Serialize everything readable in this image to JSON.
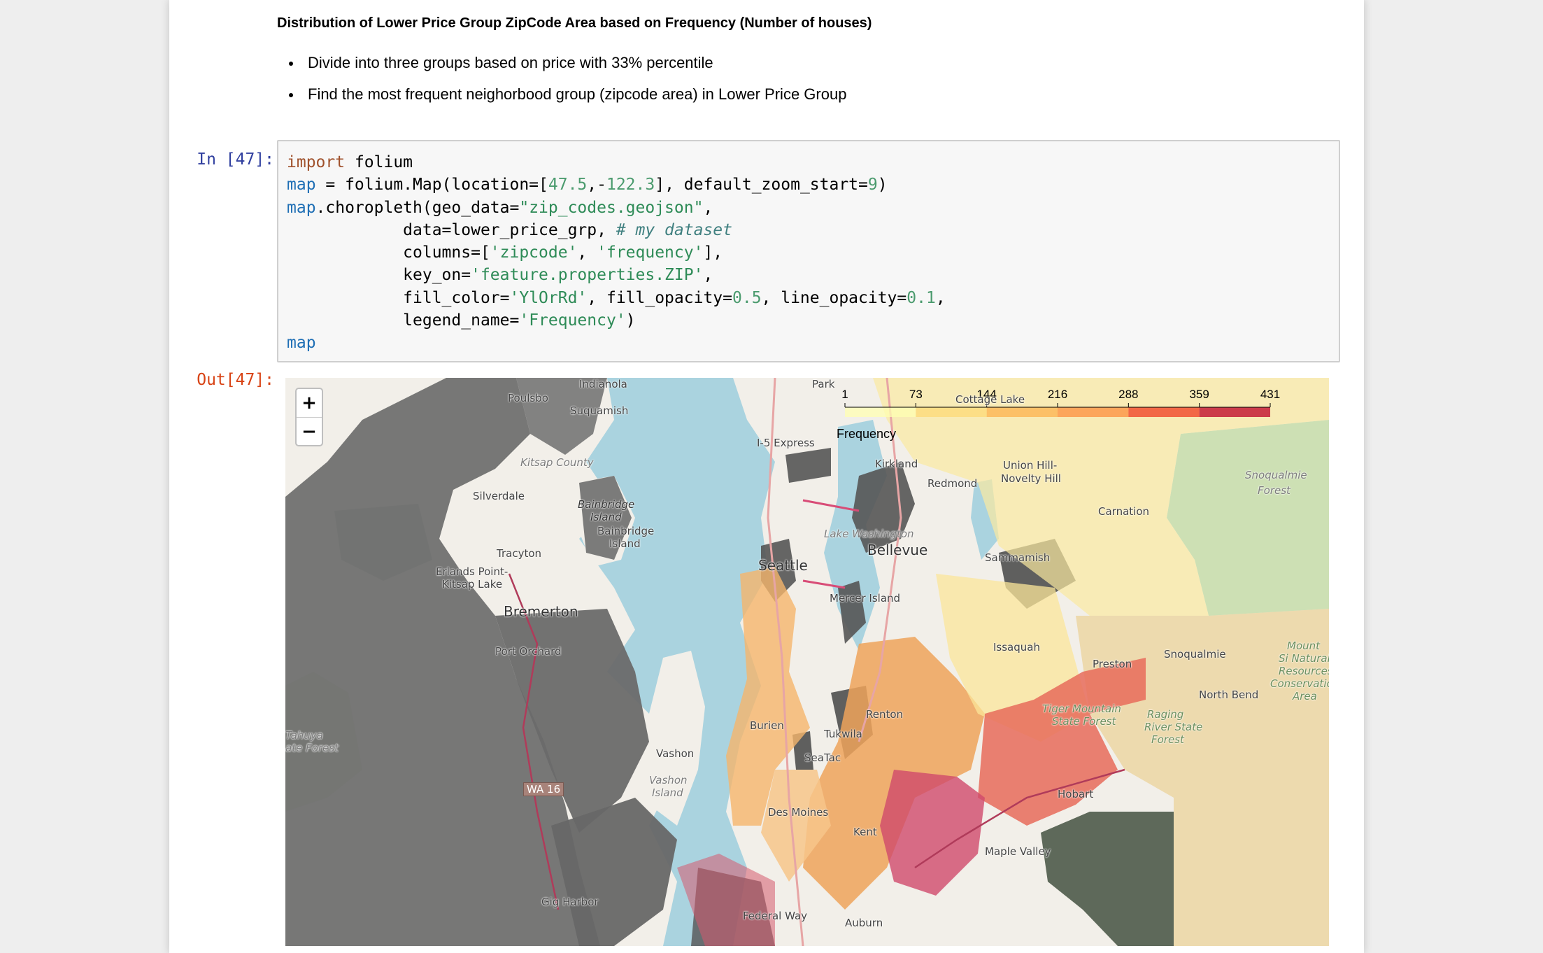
{
  "markdown": {
    "heading": "Distribution of Lower Price Group ZipCode Area based on Frequency (Number of houses)",
    "bullets": [
      "Divide into three groups based on price with 33% percentile",
      "Find the most frequent neighorbood group (zipcode area) in Lower Price Group"
    ]
  },
  "input_prompt": "In [47]:",
  "output_prompt": "Out[47]:",
  "code": {
    "line1": {
      "kw": "import",
      "rest": " folium"
    },
    "line2": {
      "v": "map",
      "a": " = folium.Map(location=[",
      "n1": "47.5",
      "b": ",-",
      "n2": "122.3",
      "c": "], default_zoom_start=",
      "n3": "9",
      "d": ")"
    },
    "line3": {
      "v": "map",
      "a": ".choropleth(geo_data=",
      "s": "\"zip_codes.geojson\"",
      "b": ","
    },
    "line4": {
      "a": "            data=lower_price_grp, ",
      "com": "# my dataset"
    },
    "line5": {
      "a": "            columns=[",
      "s1": "'zipcode'",
      "b": ", ",
      "s2": "'frequency'",
      "c": "],"
    },
    "line6": {
      "a": "            key_on=",
      "s": "'feature.properties.ZIP'",
      "b": ","
    },
    "line7": {
      "a": "            fill_color=",
      "s": "'YlOrRd'",
      "b": ", fill_opacity=",
      "n1": "0.5",
      "c": ", line_opacity=",
      "n2": "0.1",
      "d": ","
    },
    "line8": {
      "a": "            legend_name=",
      "s": "'Frequency'",
      "b": ")"
    },
    "line9": {
      "v": "map"
    }
  },
  "map": {
    "zoom_in": "+",
    "zoom_out": "−",
    "legend": {
      "title": "Frequency",
      "ticks": [
        "1",
        "73",
        "144",
        "216",
        "288",
        "359",
        "431"
      ],
      "colors": [
        "#ffffb2",
        "#fed976",
        "#feb24c",
        "#fd8d3c",
        "#f03b20",
        "#bd0026"
      ]
    },
    "places": {
      "indianola": "Indianola",
      "poulsbo": "Poulsbo",
      "suquamish": "Suquamish",
      "park": "Park",
      "kitsap_county": "Kitsap County",
      "express": "I-5 Express",
      "kirkland": "Kirkland",
      "redmond": "Redmond",
      "cottage_lake": "Cottage Lake",
      "union_hill": "Union Hill-",
      "novelty_hill": "Novelty Hill",
      "snoqualmie_forest_1": "Snoqualmie",
      "snoqualmie_forest_2": "Forest",
      "silverdale": "Silverdale",
      "bainbridge_island_a": "Bainbridge",
      "bainbridge_island_b": "Island",
      "bainbridge_island_c": "Bainbridge",
      "bainbridge_island_d": "Island",
      "carnation": "Carnation",
      "lake_washington": "Lake Washington",
      "tracyton": "Tracyton",
      "seattle": "Seattle",
      "bellevue": "Bellevue",
      "sammamish": "Sammamish",
      "erlands_point": "Erlands Point-",
      "kitsap_lake": "Kitsap Lake",
      "bremerton": "Bremerton",
      "mercer_island": "Mercer Island",
      "port_orchard": "Port Orchard",
      "issaquah": "Issaquah",
      "preston": "Preston",
      "snoqualmie": "Snoqualmie",
      "mount_si_1": "Mount",
      "mount_si_2": "Si Natural",
      "mount_si_3": "Resources",
      "mount_si_4": "Conservation",
      "mount_si_5": "Area",
      "north_bend": "North Bend",
      "renton": "Renton",
      "tiger_mountain_1": "Tiger Mountain",
      "tiger_mountain_2": "State Forest",
      "raging_river_1": "Raging",
      "raging_river_2": "River State",
      "raging_river_3": "Forest",
      "tahuya_1": "Tahuya",
      "tahuya_2": "ate Forest",
      "burien": "Burien",
      "tukwila": "Tukwila",
      "seatac": "SeaTac",
      "vashon": "Vashon",
      "vashon_island_1": "Vashon",
      "vashon_island_2": "Island",
      "hobart": "Hobart",
      "wa16": "WA 16",
      "des_moines": "Des Moines",
      "kent": "Kent",
      "maple_valley": "Maple Valley",
      "gig_harbor": "Gig Harbor",
      "federal_way": "Federal Way",
      "auburn": "Auburn"
    }
  }
}
